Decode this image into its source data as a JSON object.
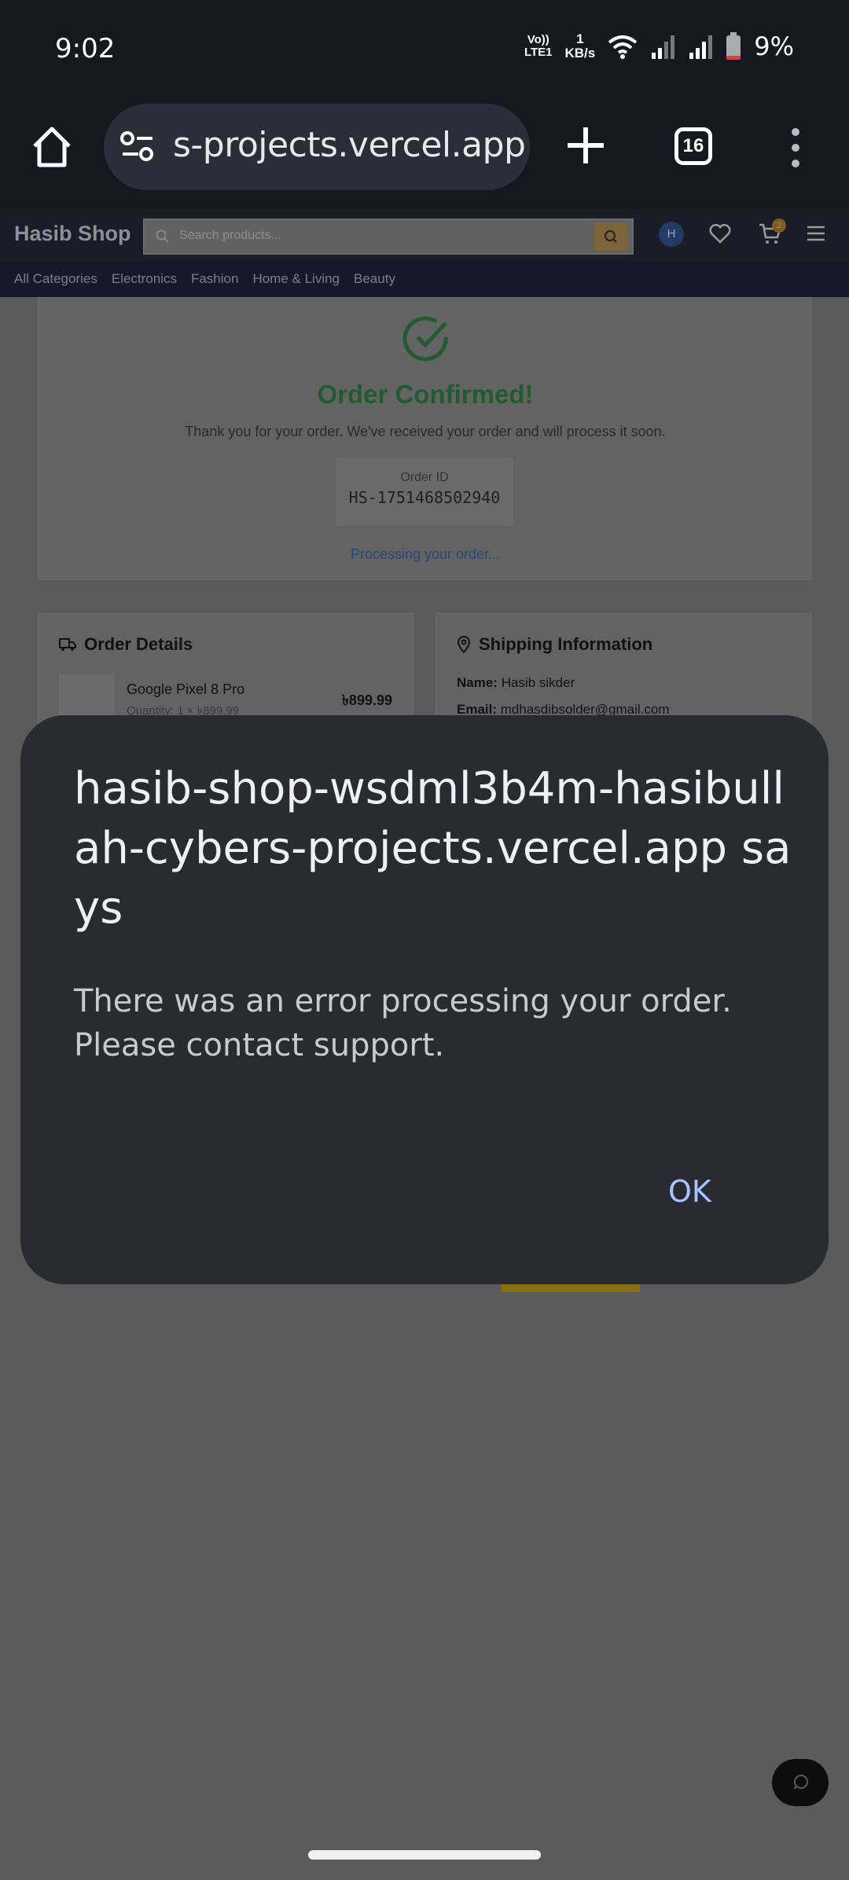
{
  "status_bar": {
    "time": "9:02",
    "volte_line1": "Vo))",
    "volte_line2": "LTE1",
    "speed_value": "1",
    "speed_unit": "KB/s",
    "battery": "9%"
  },
  "browser": {
    "url": "s-projects.vercel.app",
    "tab_count": "16"
  },
  "site": {
    "brand": "Hasib Shop",
    "search_placeholder": "Search products...",
    "avatar_initial": "H",
    "cart_count": "2",
    "categories": [
      "All Categories",
      "Electronics",
      "Fashion",
      "Home & Living",
      "Beauty"
    ]
  },
  "order": {
    "title": "Order Confirmed!",
    "thanks": "Thank you for your order. We've received your order and will process it soon.",
    "order_id_label": "Order ID",
    "order_id": "HS-1751468502940",
    "status": "Processing your order..."
  },
  "order_details": {
    "heading": "Order Details",
    "product_name": "Google Pixel 8 Pro",
    "product_qty": "Quantity: 1 × ৳899.99",
    "product_price": "৳899.99"
  },
  "shipping": {
    "heading": "Shipping Information",
    "name_label": "Name:",
    "name_value": "Hasib sikder",
    "email_label": "Email:",
    "email_value": "mdhasdibsolder@gmail.com"
  },
  "dialog": {
    "title": "hasib-shop-wsdml3b4m-hasibullah-cybers-projects.vercel.app says",
    "message": "There was an error processing your order. Please contact support.",
    "ok": "OK"
  },
  "colors": {
    "dialog_bg": "#2a2b32",
    "ok_accent": "#a9c3ff",
    "confirm_green": "#235a30"
  }
}
